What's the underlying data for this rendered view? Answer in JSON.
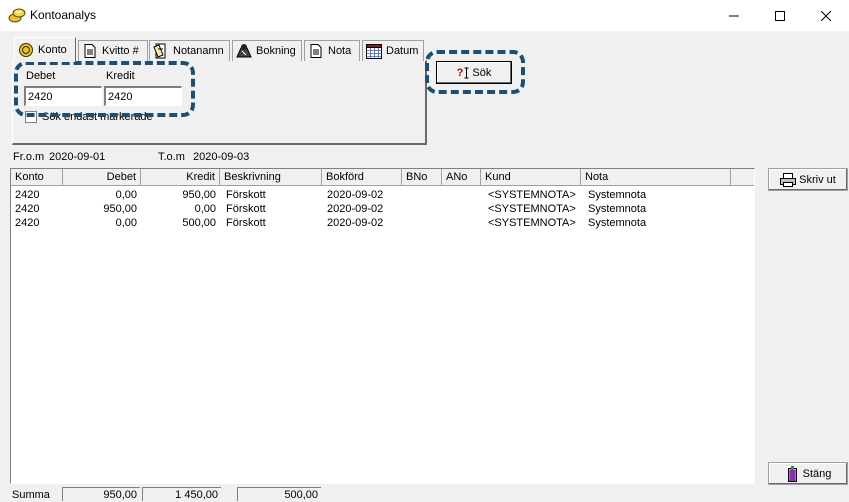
{
  "window": {
    "title": "Kontoanalys"
  },
  "tabs": [
    {
      "label": "Konto",
      "icon": "coin-icon"
    },
    {
      "label": "Kvitto #",
      "icon": "document-icon"
    },
    {
      "label": "Notanamn",
      "icon": "notes-icon"
    },
    {
      "label": "Bokning",
      "icon": "booking-icon"
    },
    {
      "label": "Nota",
      "icon": "document-icon"
    },
    {
      "label": "Datum",
      "icon": "calendar-icon"
    }
  ],
  "konto_panel": {
    "debet_label": "Debet",
    "debet_value": "2420",
    "kredit_label": "Kredit",
    "kredit_value": "2420",
    "checkbox_label": "Sök endast markerade"
  },
  "search_button": {
    "icon_text": "?",
    "label": "Sök"
  },
  "date_range": {
    "from_label": "Fr.o.m",
    "from_value": "2020-09-01",
    "to_label": "T.o.m",
    "to_value": "2020-09-03"
  },
  "table": {
    "columns": [
      "Konto",
      "Debet",
      "Kredit",
      "Beskrivning",
      "Bokförd",
      "BNo",
      "ANo",
      "Kund",
      "Nota"
    ],
    "rows": [
      [
        "2420",
        "0,00",
        "950,00",
        "Förskott",
        "2020-09-02",
        "",
        "",
        "<SYSTEMNOTA>",
        "Systemnota"
      ],
      [
        "2420",
        "950,00",
        "0,00",
        "Förskott",
        "2020-09-02",
        "",
        "",
        "<SYSTEMNOTA>",
        "Systemnota"
      ],
      [
        "2420",
        "0,00",
        "500,00",
        "Förskott",
        "2020-09-02",
        "",
        "",
        "<SYSTEMNOTA>",
        "Systemnota"
      ]
    ]
  },
  "buttons": {
    "print_label": "Skriv ut",
    "close_label": "Stäng"
  },
  "summary": {
    "label": "Summa",
    "debet": "950,00",
    "kredit": "1 450,00",
    "diff": "500,00"
  },
  "colors": {
    "highlight": "#1c4f73",
    "window_bg": "#f0f0f0"
  }
}
